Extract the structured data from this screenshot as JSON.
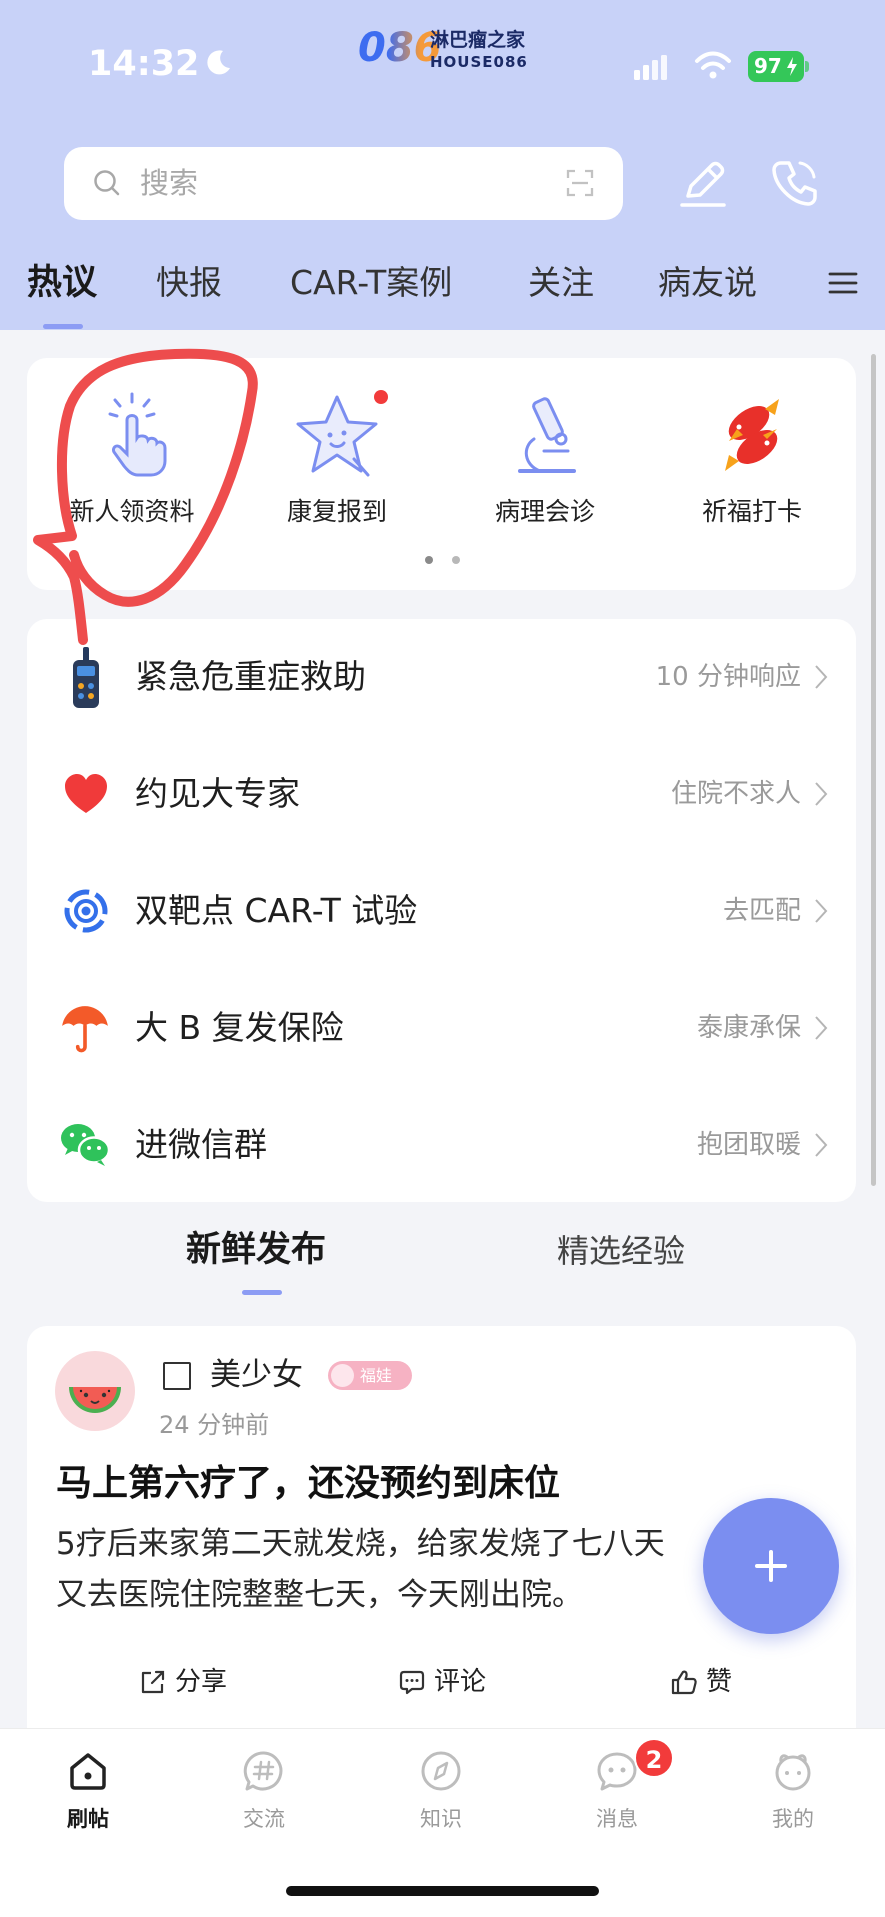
{
  "status_bar": {
    "time": "14:32",
    "battery": "97"
  },
  "logo": {
    "mark": "086",
    "name": "淋巴瘤之家",
    "sub": "HOUSE086"
  },
  "search": {
    "placeholder": "搜索"
  },
  "tabs": [
    {
      "label": "热议",
      "active": true
    },
    {
      "label": "快报"
    },
    {
      "label": "CAR-T案例"
    },
    {
      "label": "关注"
    },
    {
      "label": "病友说"
    }
  ],
  "quick_actions": [
    {
      "label": "新人领资料",
      "icon": "tap-hand-icon"
    },
    {
      "label": "康复报到",
      "icon": "star-face-icon",
      "has_dot": true
    },
    {
      "label": "病理会诊",
      "icon": "microscope-icon"
    },
    {
      "label": "祈福打卡",
      "icon": "koi-fish-icon"
    }
  ],
  "services": [
    {
      "label": "紧急危重症救助",
      "hint": "10 分钟响应",
      "icon": "walkie-talkie-icon"
    },
    {
      "label": "约见大专家",
      "hint": "住院不求人",
      "icon": "heart-icon"
    },
    {
      "label": "双靶点 CAR-T 试验",
      "hint": "去匹配",
      "icon": "target-icon"
    },
    {
      "label": "大 B 复发保险",
      "hint": "泰康承保",
      "icon": "umbrella-icon"
    },
    {
      "label": "进微信群",
      "hint": "抱团取暖",
      "icon": "wechat-icon"
    }
  ],
  "feed_tabs": [
    {
      "label": "新鲜发布",
      "active": true
    },
    {
      "label": "精选经验"
    }
  ],
  "post": {
    "author": "美少女",
    "badge": "福娃",
    "time": "24 分钟前",
    "title": "马上第六疗了，还没预约到床位",
    "body_lines": [
      "5疗后来家第二天就发烧，给家发烧了七八天",
      "又去医院住院整整七天，今天刚出院。"
    ],
    "actions": {
      "share": "分享",
      "comment": "评论",
      "like": "赞"
    }
  },
  "fab": {
    "icon": "plus-icon"
  },
  "bottom_nav": [
    {
      "label": "刷帖",
      "icon": "home-icon",
      "active": true
    },
    {
      "label": "交流",
      "icon": "hashtag-chat-icon"
    },
    {
      "label": "知识",
      "icon": "compass-icon"
    },
    {
      "label": "消息",
      "icon": "message-face-icon",
      "badge": "2"
    },
    {
      "label": "我的",
      "icon": "profile-face-icon"
    }
  ],
  "colors": {
    "header_bg": "#c8d2f8",
    "accent": "#7b8ef0",
    "page_bg": "#f3f4f8",
    "badge_red": "#f23b3b",
    "battery_green": "#34c759",
    "annotation_red": "#ec3a3a"
  }
}
